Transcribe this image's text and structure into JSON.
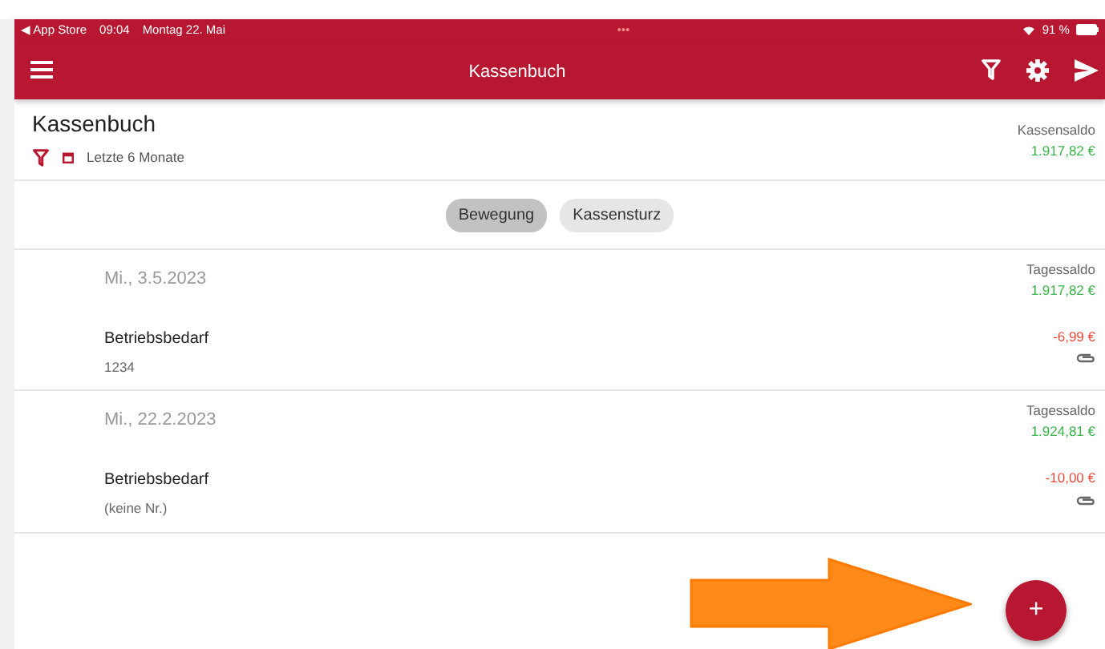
{
  "status_bar": {
    "back": "◀ App Store",
    "time": "09:04",
    "date": "Montag 22. Mai",
    "dots": "•••",
    "battery_text": "91 %"
  },
  "toolbar": {
    "title": "Kassenbuch"
  },
  "header": {
    "title": "Kassenbuch",
    "filter": "Letzte 6 Monate",
    "balance_label": "Kassensaldo",
    "balance": "1.917,82 €"
  },
  "segments": [
    {
      "label": "Bewegung",
      "selected": true
    },
    {
      "label": "Kassensturz",
      "selected": false
    }
  ],
  "days": [
    {
      "date": "Mi., 3.5.2023",
      "balance_label": "Tagessaldo",
      "balance": "1.917,82 €",
      "entries": [
        {
          "title": "Betriebsbedarf",
          "number": "1234",
          "amount": "-6,99 €",
          "attachment": true
        }
      ]
    },
    {
      "date": "Mi., 22.2.2023",
      "balance_label": "Tagessaldo",
      "balance": "1.924,81 €",
      "entries": [
        {
          "title": "Betriebsbedarf",
          "number": "(keine Nr.)",
          "amount": "-10,00 €",
          "attachment": true
        }
      ]
    }
  ],
  "fab": {
    "label": "+"
  }
}
